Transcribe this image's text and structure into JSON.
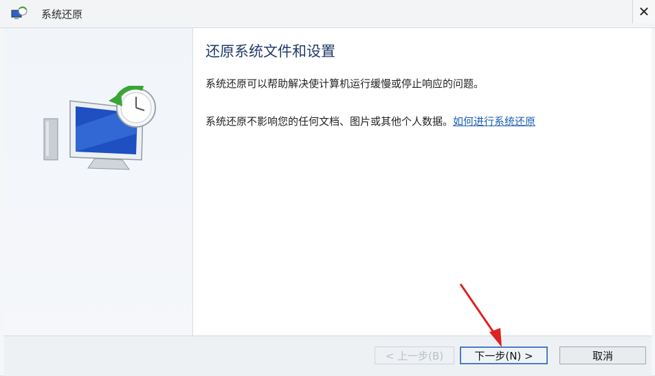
{
  "window": {
    "title": "系统还原",
    "close_symbol": "✕"
  },
  "main": {
    "heading": "还原系统文件和设置",
    "paragraph1": "系统还原可以帮助解决使计算机运行缓慢或停止响应的问题。",
    "paragraph2": "系统还原不影响您的任何文档、图片或其他个人数据。",
    "help_link": "如何进行系统还原"
  },
  "buttons": {
    "back": "< 上一步(B)",
    "next": "下一步(N) >",
    "cancel": "取消"
  },
  "colors": {
    "heading": "#1f3a68",
    "link": "#1a5fb4",
    "annotation_arrow": "#e02020"
  }
}
